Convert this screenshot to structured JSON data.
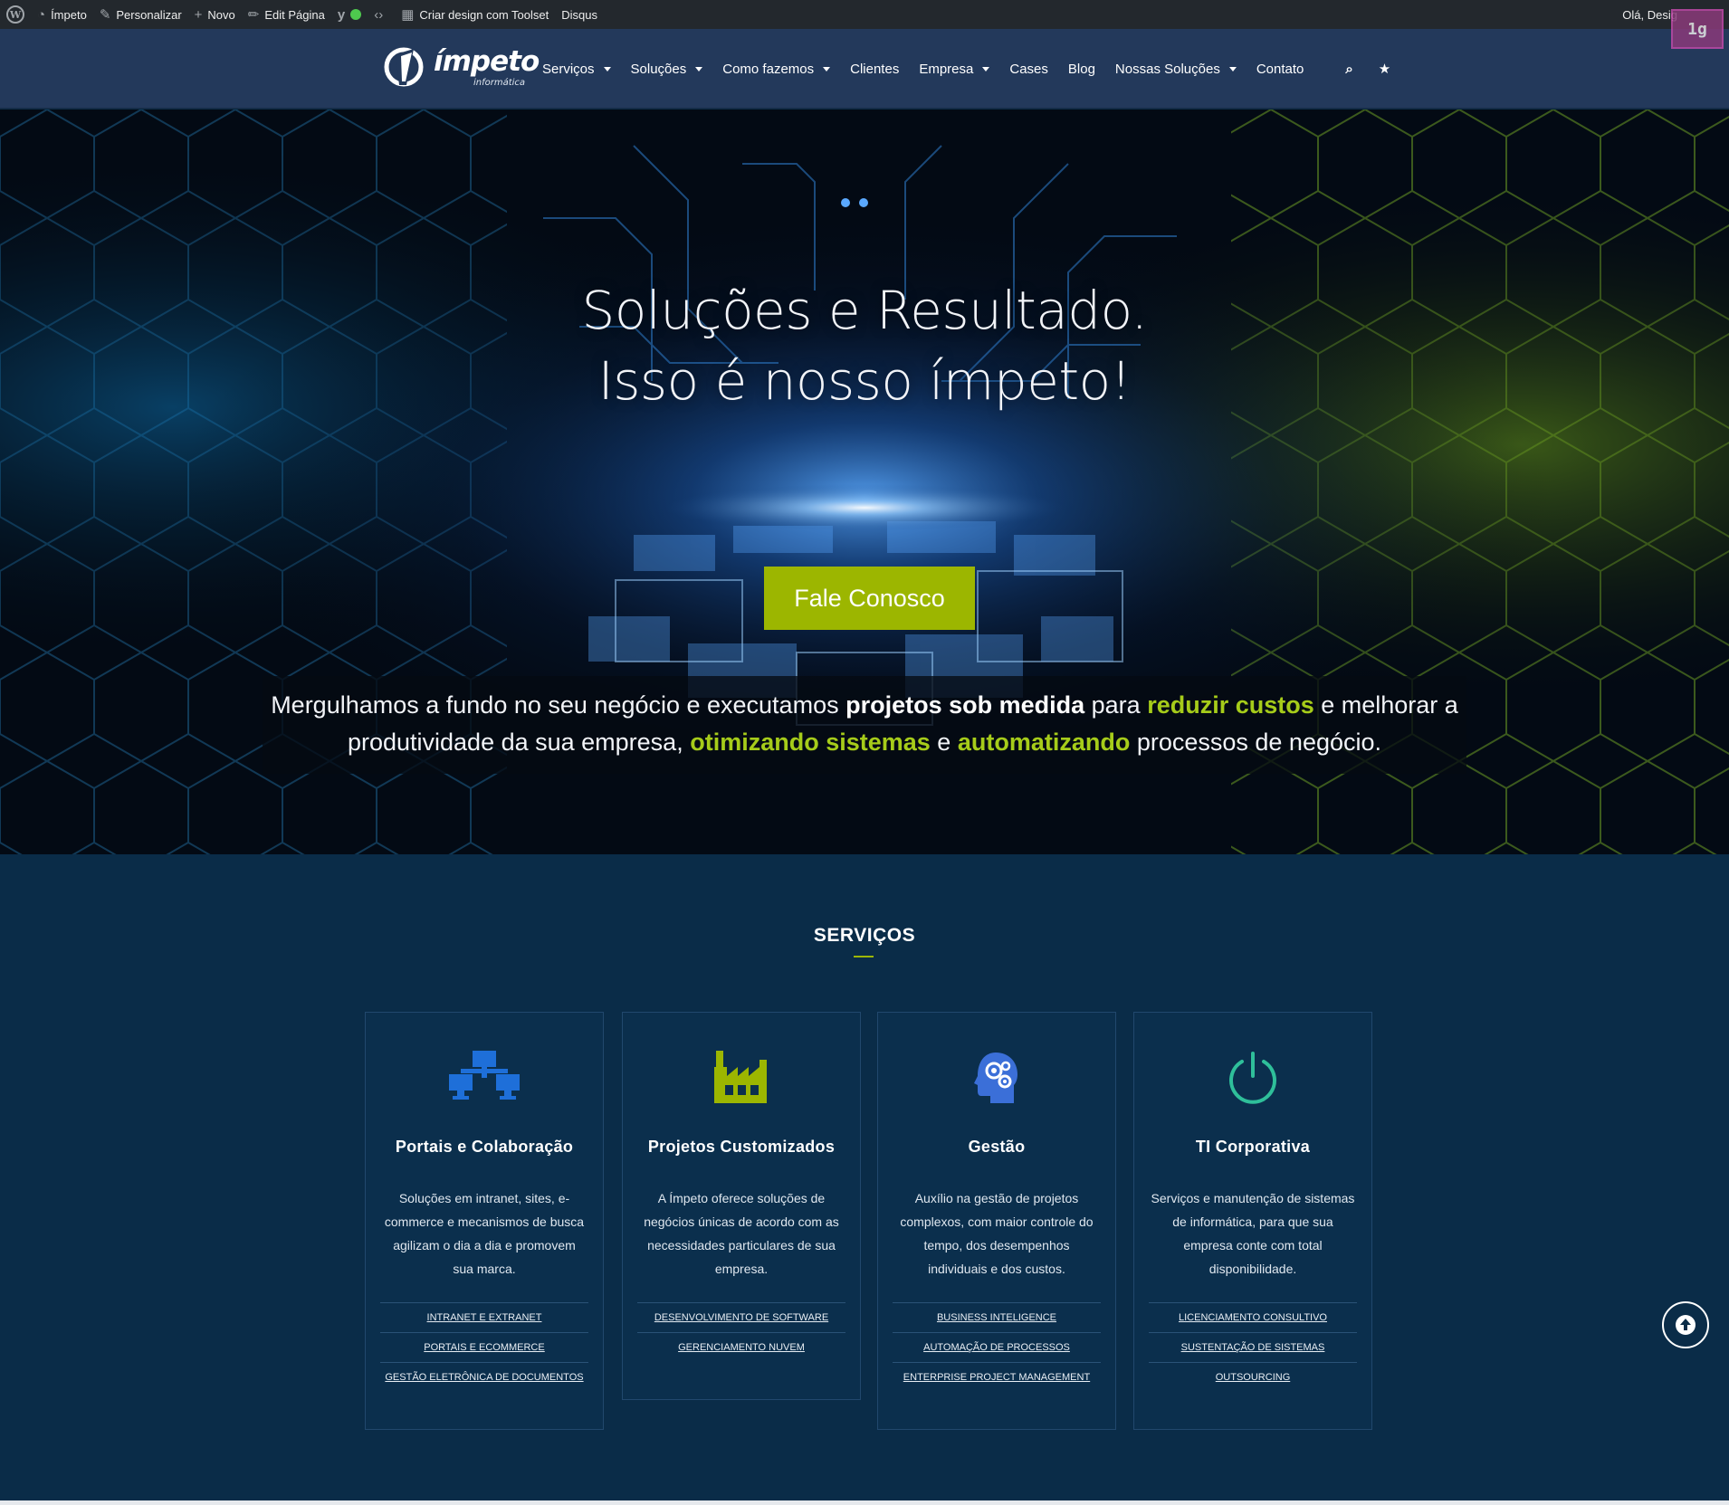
{
  "adminbar": {
    "site_name": "Ímpeto",
    "customize": "Personalizar",
    "new": "Novo",
    "edit_page": "Edit Página",
    "toolset": "Criar design com Toolset",
    "disqus": "Disqus",
    "greeting": "Olá, Desig",
    "badge": "1g"
  },
  "header": {
    "logo_text": "ímpeto",
    "logo_sub": "informática",
    "nav": [
      {
        "label": "Serviços",
        "dropdown": true
      },
      {
        "label": "Soluções",
        "dropdown": true
      },
      {
        "label": "Como fazemos",
        "dropdown": true
      },
      {
        "label": "Clientes",
        "dropdown": false
      },
      {
        "label": "Empresa",
        "dropdown": true
      },
      {
        "label": "Cases",
        "dropdown": false
      },
      {
        "label": "Blog",
        "dropdown": false
      },
      {
        "label": "Nossas Soluções",
        "dropdown": true
      },
      {
        "label": "Contato",
        "dropdown": false
      }
    ],
    "icons": [
      "search-icon",
      "star-icon"
    ]
  },
  "hero": {
    "title_line1": "Soluções e Resultado.",
    "title_line2": "Isso é nosso ímpeto!",
    "cta": "Fale Conosco",
    "lead": {
      "p1": "Mergulhamos a fundo no seu negócio e executamos ",
      "b1": "projetos sob medida",
      "p2": " para ",
      "g1": "reduzir custos",
      "p3": " e melhorar a produtividade da sua empresa, ",
      "g2": "otimizando sistemas",
      "p4": " e ",
      "g3": "automatizando",
      "p5": " processos de negócio."
    },
    "accent_color": "#9cb600"
  },
  "services": {
    "title": "SERVIÇOS",
    "cards": [
      {
        "icon": "network-icon",
        "icon_color": "#1e6fd9",
        "title": "Portais e Colaboração",
        "text": "Soluções em intranet, sites, e-commerce e mecanismos de busca agilizam o dia a dia e promovem sua marca.",
        "links": [
          "INTRANET E EXTRANET",
          "PORTAIS E ECOMMERCE",
          "GESTÃO ELETRÔNICA DE DOCUMENTOS"
        ]
      },
      {
        "icon": "factory-icon",
        "icon_color": "#9cb600",
        "title": "Projetos Customizados",
        "text": "A Ímpeto oferece soluções de negócios únicas de acordo com as necessidades particulares de sua empresa.",
        "links": [
          "DESENVOLVIMENTO DE SOFTWARE",
          "GERENCIAMENTO NUVEM"
        ]
      },
      {
        "icon": "head-gears-icon",
        "icon_color": "#3b6fd8",
        "title": "Gestão",
        "text": "Auxílio na gestão de projetos complexos, com maior controle do tempo, dos desempenhos individuais e dos custos.",
        "links": [
          "BUSINESS INTELIGENCE",
          "AUTOMAÇÃO DE PROCESSOS",
          "ENTERPRISE PROJECT MANAGEMENT"
        ]
      },
      {
        "icon": "power-icon",
        "icon_color": "#2fbf9a",
        "title": "TI Corporativa",
        "text": "Serviços e manutenção de sistemas de informática, para que sua empresa conte com total disponibilidade.",
        "links": [
          "LICENCIAMENTO CONSULTIVO",
          "SUSTENTAÇÃO DE SISTEMAS",
          "OUTSOURCING"
        ]
      }
    ]
  }
}
